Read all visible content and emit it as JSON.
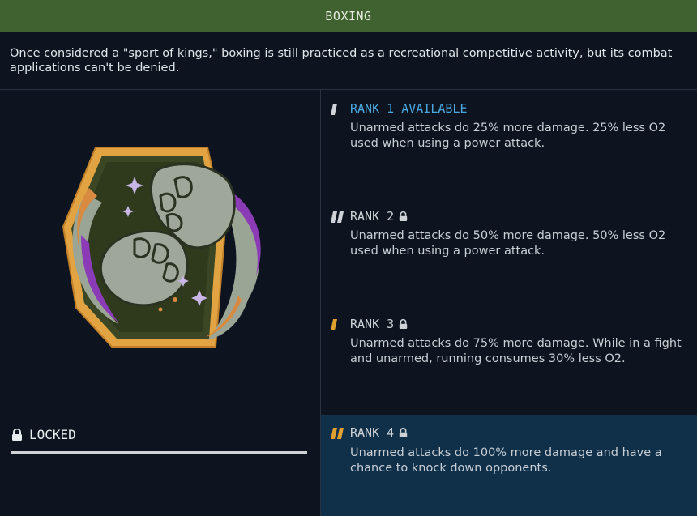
{
  "header": {
    "title": "BOXING"
  },
  "description": "Once considered a \"sport of kings,\" boxing is still practiced as a recreational competitive activity, but its combat applications can't be denied.",
  "status": {
    "label": "LOCKED",
    "progress_fraction": 1.0
  },
  "ranks": [
    {
      "title": "RANK 1 AVAILABLE",
      "locked": false,
      "color": "#4aa8e0",
      "text": "Unarmed attacks do 25% more damage. 25% less O2 used when using a power attack."
    },
    {
      "title": "RANK 2",
      "locked": true,
      "color": "#cfd3d7",
      "text": "Unarmed attacks do 50% more damage. 50% less O2 used when using a power attack."
    },
    {
      "title": "RANK 3",
      "locked": true,
      "color": "#cfd3d7",
      "text": "Unarmed attacks do 75% more damage. While in a fight and unarmed, running consumes 30% less O2."
    },
    {
      "title": "RANK 4",
      "locked": true,
      "color": "#cfd3d7",
      "text": "Unarmed attacks do 100% more damage and have a chance to knock down opponents."
    }
  ],
  "colors": {
    "header_bg": "#3f6230",
    "background": "#0d1420",
    "rank_accent": "#e0a030",
    "rank_active_blue": "#4aa8e0",
    "selected_row_bg": "#10304a"
  },
  "icons": {
    "badge": "boxing-fists-badge-icon",
    "lock": "lock-icon"
  }
}
